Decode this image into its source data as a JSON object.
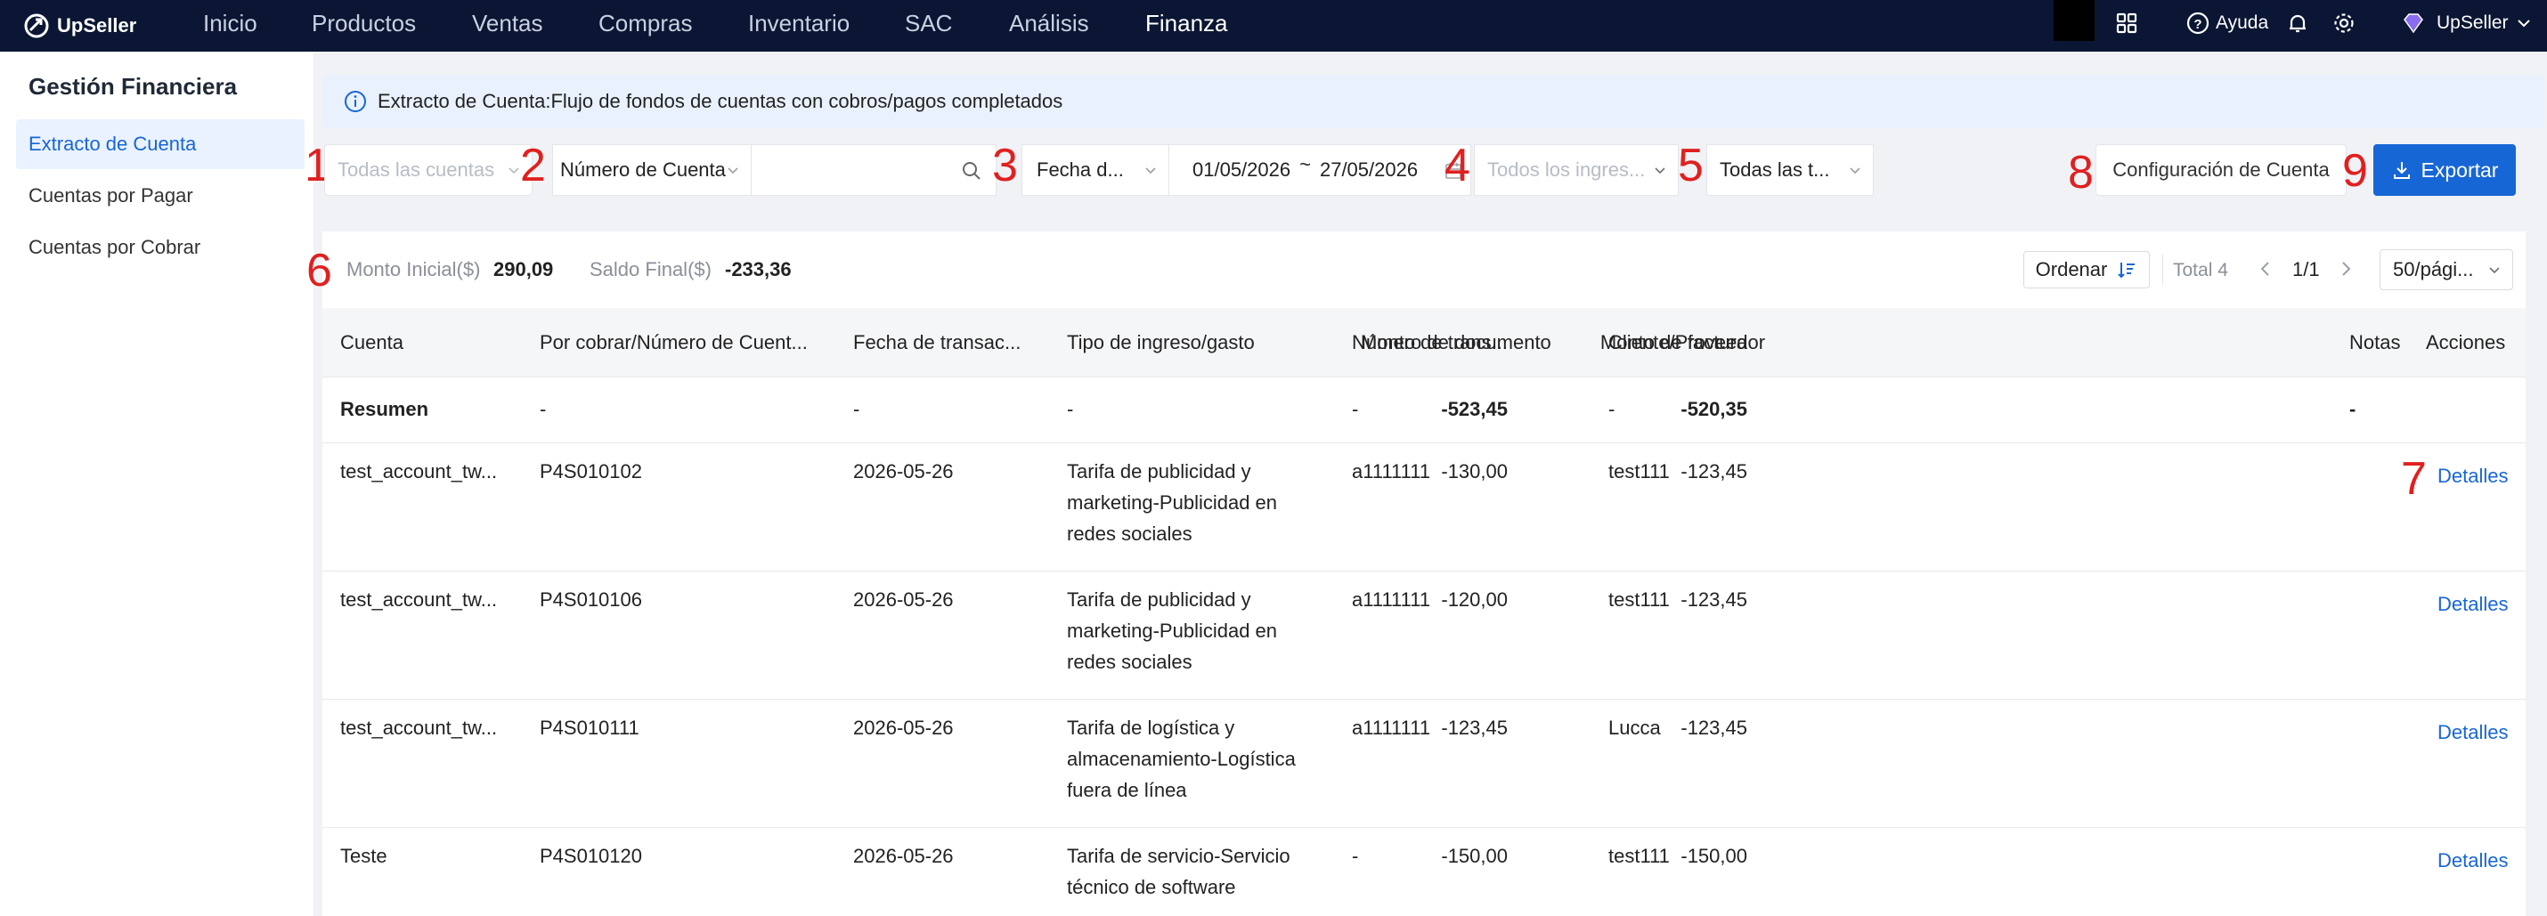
{
  "nav": {
    "brand": "UpSeller",
    "items": [
      "Inicio",
      "Productos",
      "Ventas",
      "Compras",
      "Inventario",
      "SAC",
      "Análisis",
      "Finanza"
    ],
    "active": "Finanza",
    "help": "Ayuda",
    "user": "UpSeller"
  },
  "sidebar": {
    "title": "Gestión Financiera",
    "items": [
      "Extracto de Cuenta",
      "Cuentas por Pagar",
      "Cuentas por Cobrar"
    ]
  },
  "info": {
    "text": "Extracto de Cuenta:Flujo de fondos de cuentas con cobros/pagos completados"
  },
  "filters": {
    "account_placeholder": "Todas las cuentas",
    "search_type": "Número de Cuenta",
    "date_type": "Fecha d...",
    "date_from": "01/05/2026",
    "date_sep": "~",
    "date_to": "27/05/2026",
    "type_placeholder": "Todos los ingres...",
    "all_types": "Todas las t..."
  },
  "actions": {
    "config": "Configuración de Cuenta",
    "export": "Exportar"
  },
  "annotations": [
    "1",
    "2",
    "3",
    "4",
    "5",
    "6",
    "7",
    "8",
    "9"
  ],
  "summary": {
    "initial_label": "Monto Inicial($)",
    "initial_value": "290,09",
    "final_label": "Saldo Final($)",
    "final_value": "-233,36"
  },
  "pager": {
    "sort": "Ordenar",
    "total": "Total 4",
    "page": "1/1",
    "page_size": "50/pági..."
  },
  "table": {
    "headers": [
      "Cuenta",
      "Por cobrar/Número de Cuent...",
      "Fecha de transac...",
      "Tipo de ingreso/gasto",
      "Número de documento",
      "Cliente/Proveedor",
      "Monto de trans...",
      "Monto de factura",
      "Notas",
      "Acciones"
    ],
    "summary_row": {
      "label": "Resumen",
      "c1": "-",
      "c2": "-",
      "c3": "-",
      "c4": "-",
      "c5": "-",
      "amount": "-523,45",
      "invoice": "-520,35",
      "notes": "-"
    },
    "rows": [
      {
        "account": "test_account_tw...",
        "number": "P4S010102",
        "date": "2026-05-26",
        "type": [
          "Tarifa de publicidad y",
          "marketing-Publicidad en",
          "redes sociales"
        ],
        "doc": "a1111111",
        "client": "test111",
        "amount": "-130,00",
        "invoice": "-123,45",
        "action": "Detalles"
      },
      {
        "account": "test_account_tw...",
        "number": "P4S010106",
        "date": "2026-05-26",
        "type": [
          "Tarifa de publicidad y",
          "marketing-Publicidad en",
          "redes sociales"
        ],
        "doc": "a1111111",
        "client": "test111",
        "amount": "-120,00",
        "invoice": "-123,45",
        "action": "Detalles"
      },
      {
        "account": "test_account_tw...",
        "number": "P4S010111",
        "date": "2026-05-26",
        "type": [
          "Tarifa de logística y",
          "almacenamiento-Logística",
          "fuera de línea"
        ],
        "doc": "a1111111",
        "client": "Lucca",
        "amount": "-123,45",
        "invoice": "-123,45",
        "action": "Detalles"
      },
      {
        "account": "Teste",
        "number": "P4S010120",
        "date": "2026-05-26",
        "type": [
          "Tarifa de servicio-Servicio",
          "técnico de software"
        ],
        "doc": "-",
        "client": "test111",
        "amount": "-150,00",
        "invoice": "-150,00",
        "action": "Detalles"
      }
    ]
  }
}
